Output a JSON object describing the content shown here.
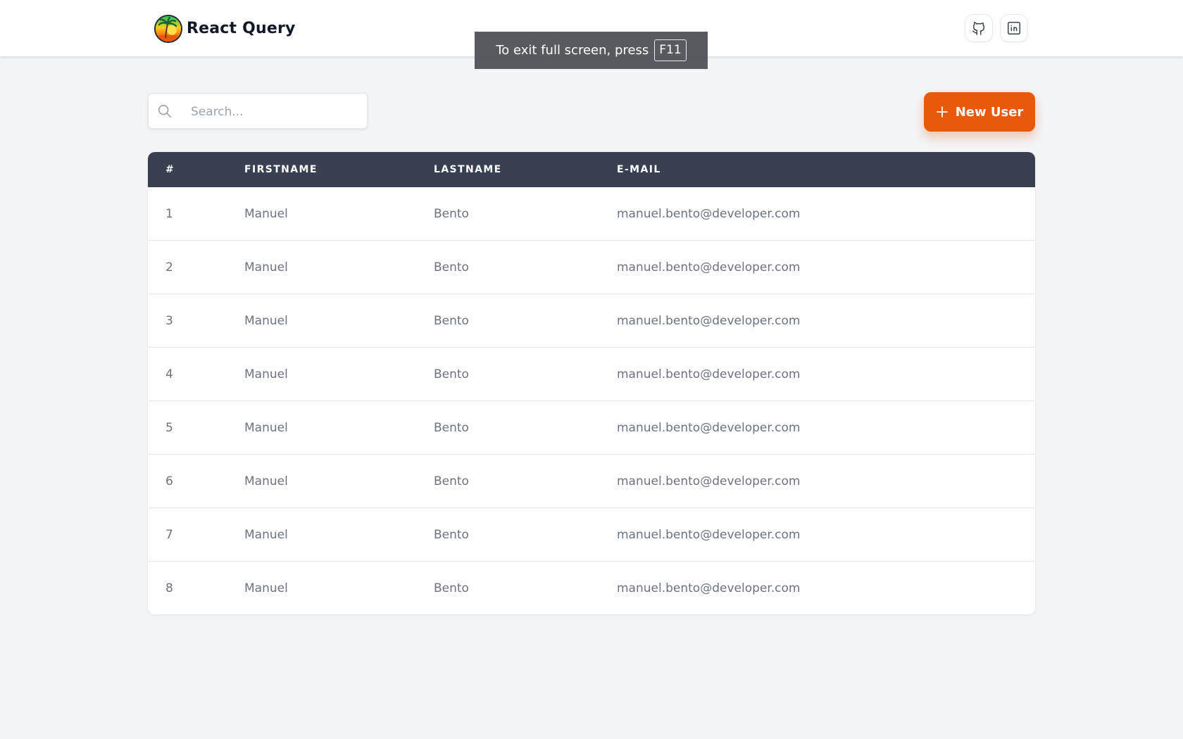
{
  "app": {
    "title": "React Query",
    "logo_icon": "palm-tree-sunset-logo"
  },
  "header": {
    "social_links": [
      {
        "name": "github",
        "icon": "github-icon"
      },
      {
        "name": "linkedin",
        "icon": "linkedin-icon"
      }
    ]
  },
  "fullscreen_notice": {
    "text": "To exit full screen, press",
    "key": "F11"
  },
  "toolbar": {
    "search_placeholder": "Search...",
    "search_value": "",
    "new_user_label": "New User"
  },
  "table": {
    "columns": [
      "#",
      "FIRSTNAME",
      "LASTNAME",
      "E-MAIL"
    ],
    "rows": [
      {
        "id": "1",
        "firstname": "Manuel",
        "lastname": "Bento",
        "email": "manuel.bento@developer.com"
      },
      {
        "id": "2",
        "firstname": "Manuel",
        "lastname": "Bento",
        "email": "manuel.bento@developer.com"
      },
      {
        "id": "3",
        "firstname": "Manuel",
        "lastname": "Bento",
        "email": "manuel.bento@developer.com"
      },
      {
        "id": "4",
        "firstname": "Manuel",
        "lastname": "Bento",
        "email": "manuel.bento@developer.com"
      },
      {
        "id": "5",
        "firstname": "Manuel",
        "lastname": "Bento",
        "email": "manuel.bento@developer.com"
      },
      {
        "id": "6",
        "firstname": "Manuel",
        "lastname": "Bento",
        "email": "manuel.bento@developer.com"
      },
      {
        "id": "7",
        "firstname": "Manuel",
        "lastname": "Bento",
        "email": "manuel.bento@developer.com"
      },
      {
        "id": "8",
        "firstname": "Manuel",
        "lastname": "Bento",
        "email": "manuel.bento@developer.com"
      }
    ]
  },
  "colors": {
    "accent": "#ea580c",
    "table_header": "#374151",
    "page_background": "#f3f4f6"
  }
}
